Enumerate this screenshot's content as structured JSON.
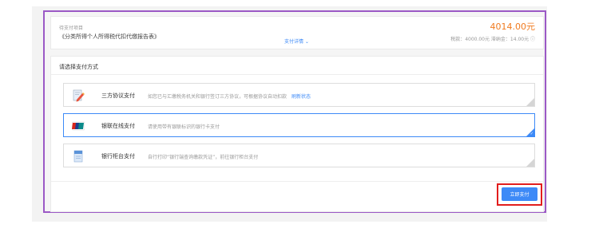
{
  "order": {
    "label": "待支付项目",
    "title": "《分类所得个人所得税代扣代缴报告表》",
    "detail_link": "支付详情 ⌄",
    "amount": "4014.00元",
    "tax_info": "税款：4000.00元  滞纳金：14.00元 ⓘ"
  },
  "payment": {
    "section_title": "请选择支付方式",
    "options": [
      {
        "name": "三方协议支付",
        "desc": "如您已与汇缴税务机关和银行签订三方协议，可根据协议自动扣款",
        "link": "刷新状态",
        "icon": "pen-icon"
      },
      {
        "name": "银联在线支付",
        "desc": "请使用带有银联标识的银行卡支付",
        "icon": "unionpay-icon"
      },
      {
        "name": "银行柜台支付",
        "desc": "自行打印“银行端查询缴款凭证”，前往银行柜台支付",
        "icon": "document-icon"
      }
    ],
    "selected_index": 1,
    "submit_label": "立即支付"
  },
  "colors": {
    "accent": "#3d8af7",
    "amount": "#f07a1f",
    "highlight_outline": "#e21d1d",
    "frame": "#9b59c6"
  }
}
